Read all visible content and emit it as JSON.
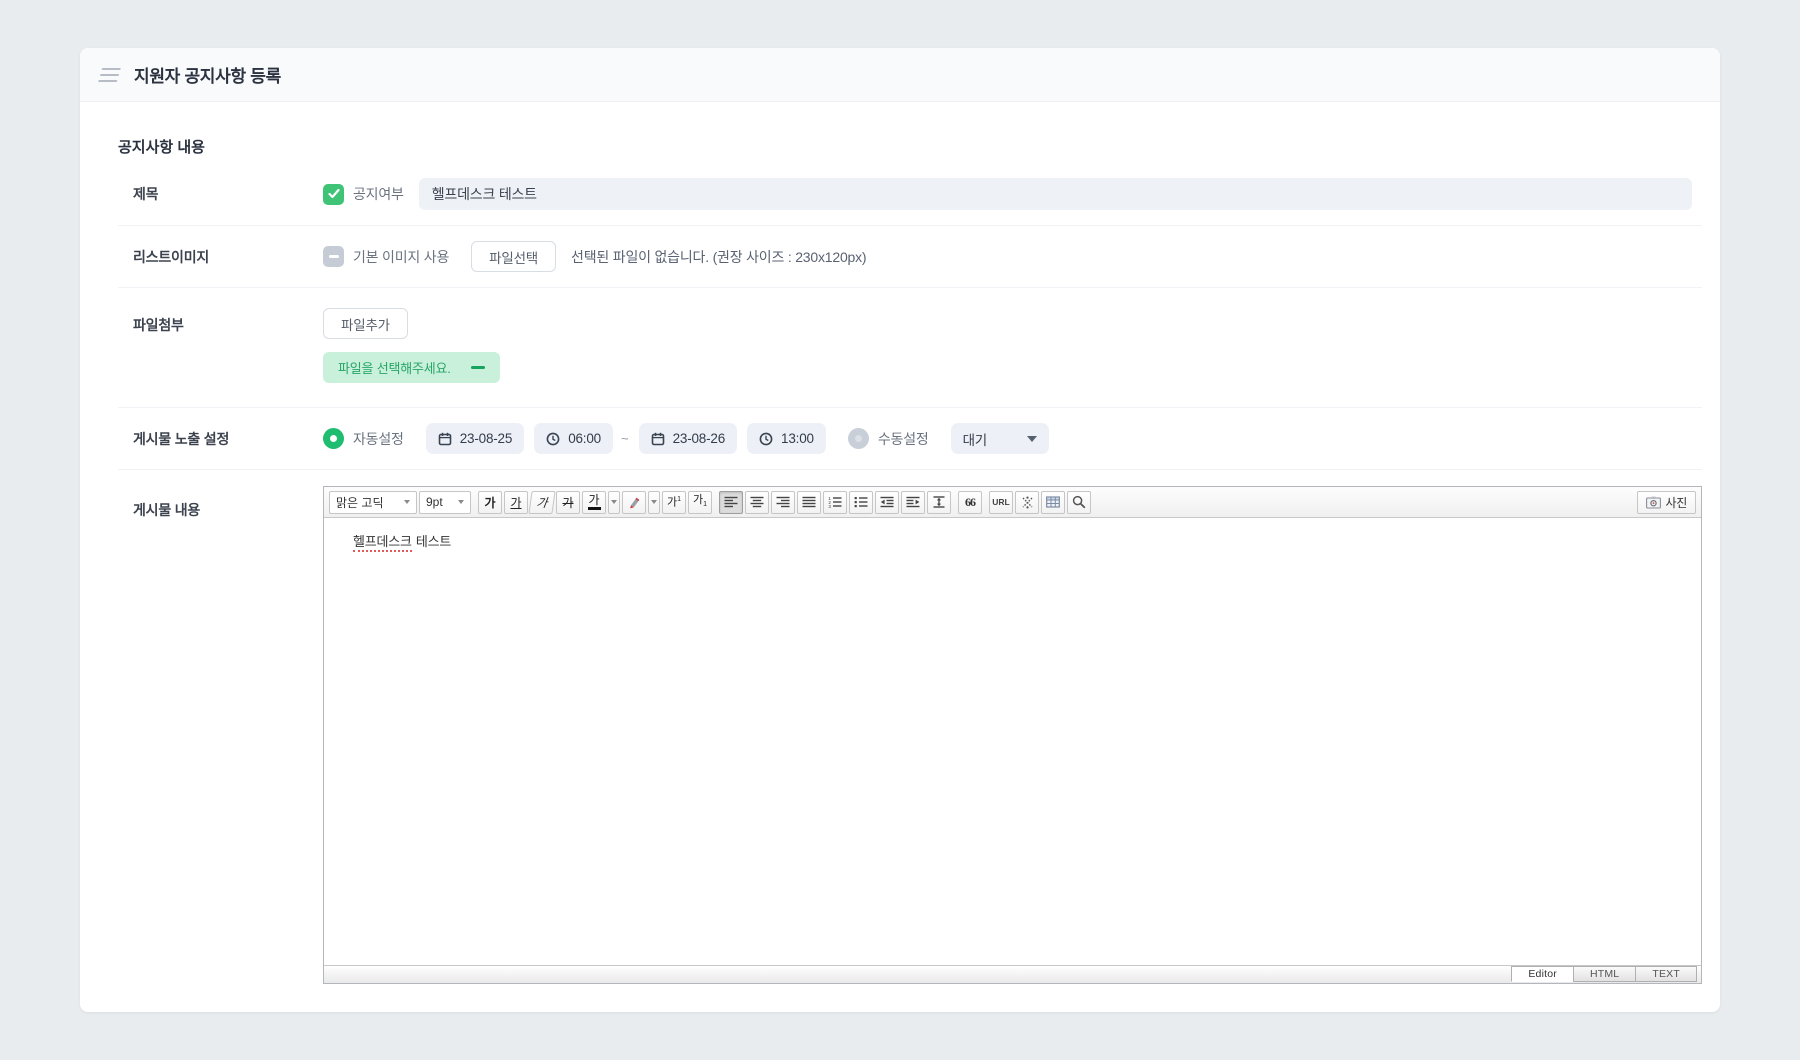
{
  "header": {
    "title": "지원자 공지사항 등록"
  },
  "section": {
    "title": "공지사항 내용"
  },
  "rows": {
    "title": {
      "label": "제목",
      "notice_checkbox_label": "공지여부",
      "value": "헬프데스크 테스트"
    },
    "list_image": {
      "label": "리스트이미지",
      "use_default_label": "기본 이미지 사용",
      "file_select_button": "파일선택",
      "empty_text": "선택된 파일이 없습니다. (권장 사이즈 : 230x120px)"
    },
    "attachment": {
      "label": "파일첨부",
      "add_file_button": "파일추가",
      "placeholder_text": "파일을 선택해주세요."
    },
    "exposure": {
      "label": "게시물 노출 설정",
      "auto_label": "자동설정",
      "manual_label": "수동설정",
      "start_date": "23-08-25",
      "start_time": "06:00",
      "tilde": "~",
      "end_date": "23-08-26",
      "end_time": "13:00",
      "status_value": "대기"
    },
    "content": {
      "label": "게시물 내용"
    }
  },
  "editor": {
    "font_family": "맑은 고딕",
    "font_size": "9pt",
    "glyphs": {
      "char": "가",
      "sup": "1",
      "sub": "1",
      "quote": "66",
      "url": "URL"
    },
    "photo_label": "사진",
    "content": {
      "spell_word": "헬프데스크",
      "rest": "테스트"
    },
    "tabs": [
      {
        "label": "Editor"
      },
      {
        "label": "HTML"
      },
      {
        "label": "TEXT"
      }
    ]
  },
  "colors": {
    "accent_green": "#2ebd72",
    "field_bg": "#edf1f7",
    "notice_bg": "#c9f0da",
    "notice_text": "#27a567",
    "header_bg": "#f9fafc"
  }
}
